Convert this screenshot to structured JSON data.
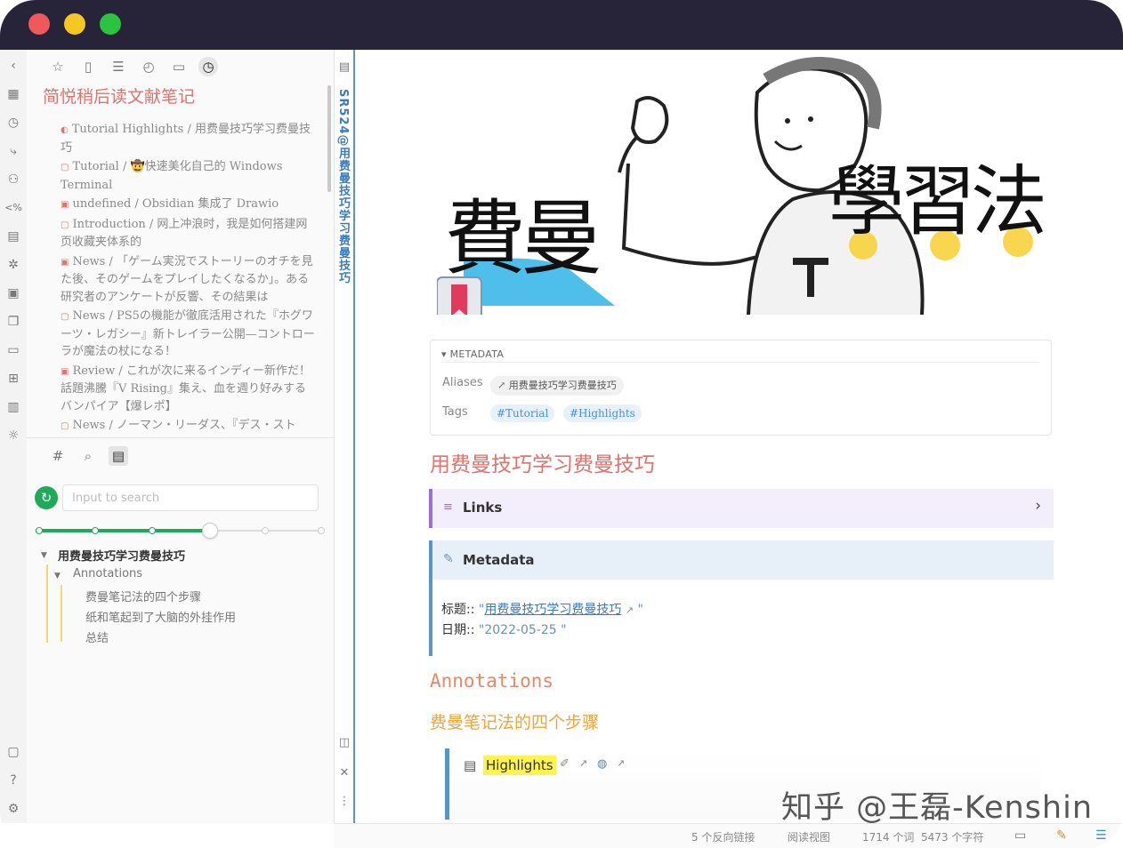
{
  "window": {
    "traffic_lights": [
      "#ee5a5b",
      "#f6c623",
      "#2bc340"
    ]
  },
  "ribbon_icons": [
    "chevron-left-icon",
    "table-icon",
    "clock-circle-icon",
    "branch-icon",
    "graph-icon",
    "code-icon",
    "template-icon",
    "network-icon",
    "calendar-icon",
    "copy-icon",
    "stack-icon",
    "plugin-icon",
    "grid-icon",
    "sun-icon",
    "camera-icon",
    "help-icon",
    "settings-icon"
  ],
  "left_tabs": [
    "star-icon",
    "file-icon",
    "list-icon",
    "clock-icon",
    "folder-icon",
    "recent-files-icon"
  ],
  "recent": {
    "title": "简悦稍后读文献笔记",
    "entries": [
      "Tutorial Highlights / 用费曼技巧学习费曼技巧",
      "Tutorial / 🤠快速美化自己的 Windows Terminal",
      "undefined / Obsidian 集成了 Drawio",
      "Introduction / 网上冲浪时，我是如何搭建网页收藏夹体系的",
      "News / 「ゲーム実況でストーリーのオチを見た後、そのゲームをプレイしたくなるか」。ある研究者のアンケートが反響、その結果は",
      "News / PS5の機能が徹底活用された『ホグワーツ・レガシー』新トレイラー公開—コントローラが魔法の杖になる！",
      "Review / これが次に来るインディー新作だ！話題沸騰『V Rising』集え、血を週り好みするバンパイア【爆レポ】",
      "News / ノーマン・リーダス、『デス・スト"
    ]
  },
  "lower_tabs": [
    "hash-icon",
    "search-icon",
    "outline-icon"
  ],
  "search": {
    "value": "",
    "placeholder": "Input to search"
  },
  "outline": {
    "root": "用费曼技巧学习费曼技巧",
    "group": "Annotations",
    "items": [
      "费曼笔记法的四个步骤",
      "纸和笔起到了大脑的外挂作用",
      "总结"
    ]
  },
  "vertical_title": "SR524@用费曼技巧学习费曼技巧",
  "cover_text": {
    "left": "費曼",
    "right": "學習法"
  },
  "metadata": {
    "header": "METADATA",
    "aliases_label": "Aliases",
    "alias": "用费曼技巧学习费曼技巧",
    "tags_label": "Tags",
    "tags": [
      "#Tutorial",
      "#Highlights"
    ]
  },
  "note": {
    "title": "用费曼技巧学习费曼技巧",
    "links_label": "Links",
    "metadata_label": "Metadata",
    "title_key": "标题",
    "title_value": "用费曼技巧学习费曼技巧",
    "date_key": "日期",
    "date_value": "2022-05-25",
    "annotations": "Annotations",
    "step_heading": "费曼笔记法的四个步骤",
    "highlight_label": "Highlights"
  },
  "status": {
    "backlinks": "5 个反向链接",
    "view": "阅读视图",
    "words": "1714 个词",
    "chars": "5473 个字符"
  },
  "watermark": "知乎 @王磊-Kenshin"
}
